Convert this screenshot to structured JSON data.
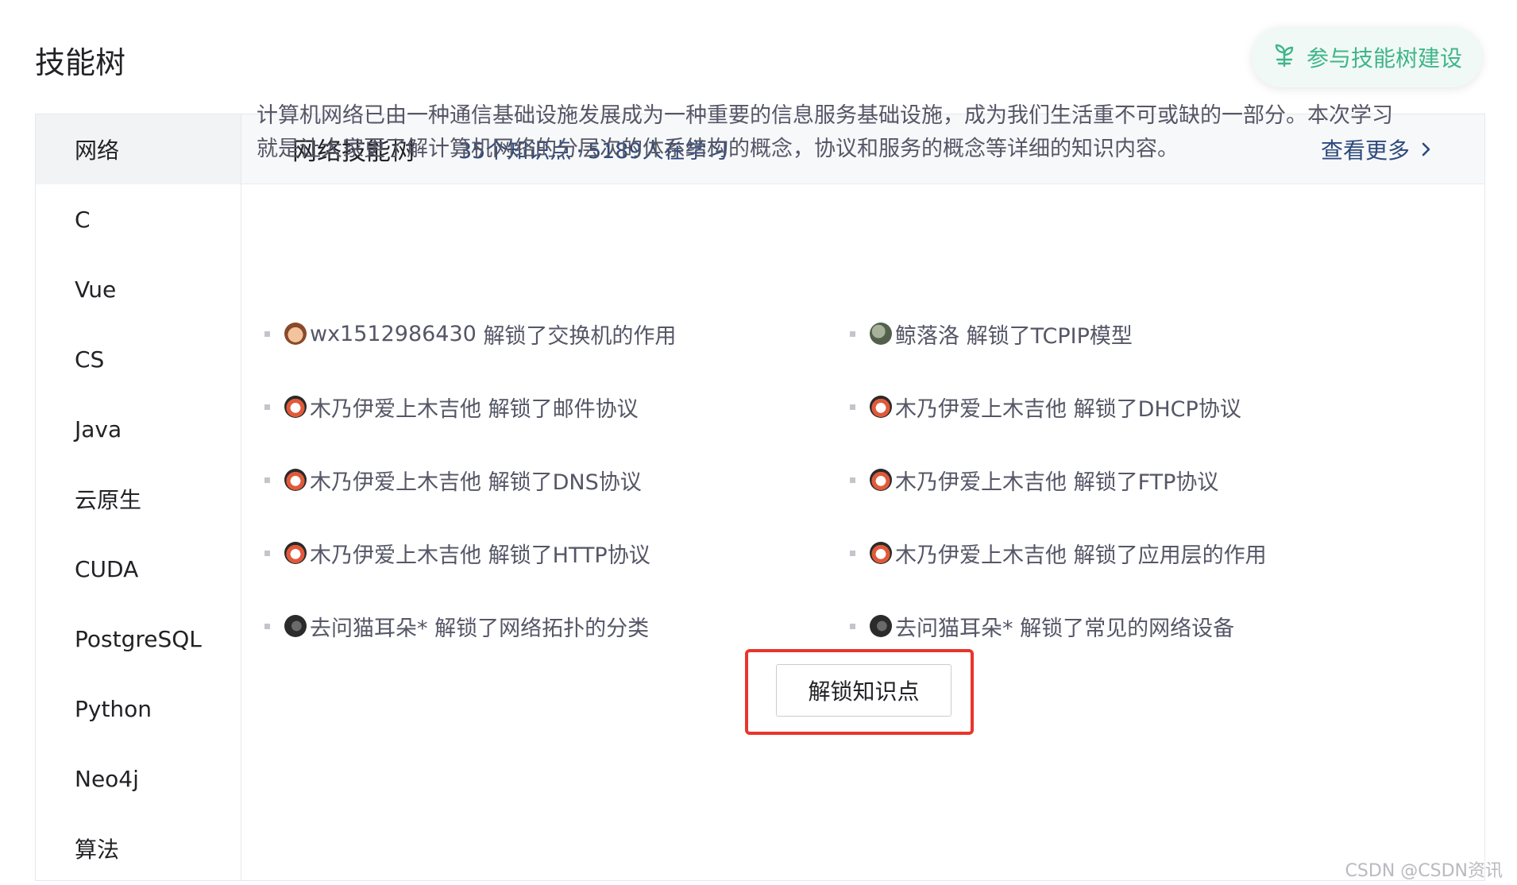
{
  "page": {
    "title": "技能树"
  },
  "contribute": {
    "label": "参与技能树建设",
    "icon": "seedling-icon",
    "color": "#3fb58a"
  },
  "sidebar": {
    "items": [
      {
        "label": "网络",
        "active": true
      },
      {
        "label": "C"
      },
      {
        "label": "Vue"
      },
      {
        "label": "CS"
      },
      {
        "label": "Java"
      },
      {
        "label": "云原生"
      },
      {
        "label": "CUDA"
      },
      {
        "label": "PostgreSQL"
      },
      {
        "label": "Python"
      },
      {
        "label": "Neo4j"
      },
      {
        "label": "算法"
      }
    ]
  },
  "header": {
    "title": "网络技能树",
    "points": "35个知识点",
    "separator": "·",
    "learners": "5189人在学习",
    "view_more": "查看更多",
    "view_more_icon": "chevron-right-icon"
  },
  "description": "计算机网络已由一种通信基础设施发展成为一种重要的信息服务基础设施，成为我们生活重不可或缺的一部分。本次学习就是让大家更了解计算机网络的分层次的体系结构的概念，协议和服务的概念等详细的知识内容。",
  "feed": [
    {
      "user": "wx1512986430",
      "text": "解锁了交换机的作用"
    },
    {
      "user": "鲸落洛",
      "text": "解锁了TCPIP模型"
    },
    {
      "user": "木乃伊爱上木吉他",
      "text": "解锁了邮件协议"
    },
    {
      "user": "木乃伊爱上木吉他",
      "text": "解锁了DHCP协议"
    },
    {
      "user": "木乃伊爱上木吉他",
      "text": "解锁了DNS协议"
    },
    {
      "user": "木乃伊爱上木吉他",
      "text": "解锁了FTP协议"
    },
    {
      "user": "木乃伊爱上木吉他",
      "text": "解锁了HTTP协议"
    },
    {
      "user": "木乃伊爱上木吉他",
      "text": "解锁了应用层的作用"
    },
    {
      "user": "去问猫耳朵*",
      "text": "解锁了网络拓扑的分类"
    },
    {
      "user": "去问猫耳朵*",
      "text": "解锁了常见的网络设备"
    }
  ],
  "unlock_button": {
    "label": "解锁知识点"
  },
  "highlight_color": "#e8352b",
  "watermark": "CSDN @CSDN资讯"
}
